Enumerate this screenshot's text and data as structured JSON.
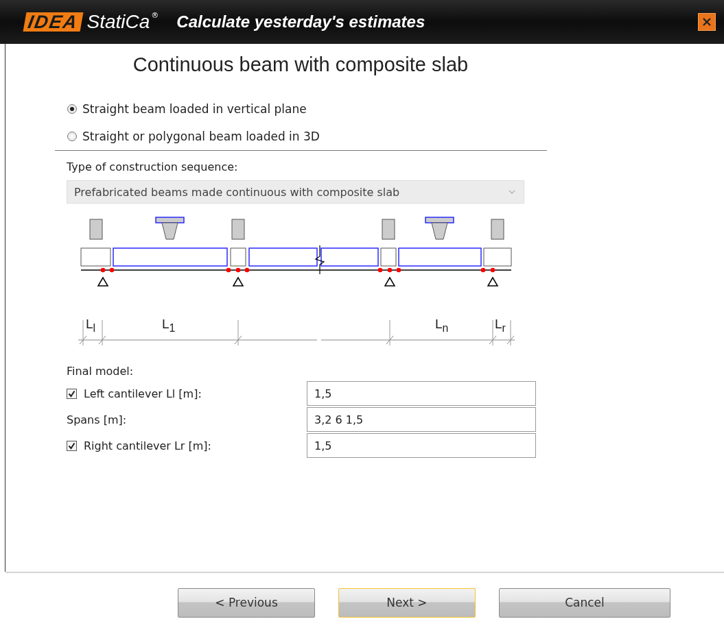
{
  "window": {
    "logo_mark": "IDEA",
    "logo_name": "StatiCa",
    "logo_registered": "®",
    "title": "Calculate yesterday's estimates"
  },
  "heading": "Continuous beam with composite slab",
  "beam_types": [
    {
      "label": "Straight beam loaded in vertical plane",
      "selected": true
    },
    {
      "label": "Straight or polygonal beam loaded in 3D",
      "selected": false
    }
  ],
  "sequence": {
    "label": "Type of construction sequence:",
    "value": "Prefabricated beams made continuous with composite slab",
    "disabled": true
  },
  "diagram": {
    "dimension_labels": [
      "L$_{l}$",
      "L$_{1}$",
      "L$_{n}$",
      "L$_{r}$"
    ]
  },
  "final_model": {
    "label": "Final model:",
    "fields": [
      {
        "kind": "checkbox",
        "label": "Left cantilever Ll [m]:",
        "checked": true,
        "value": "1,5"
      },
      {
        "kind": "plain",
        "label": "Spans [m]:",
        "value": "3,2 6 1,5"
      },
      {
        "kind": "checkbox",
        "label": "Right cantilever Lr [m]:",
        "checked": true,
        "value": "1,5"
      }
    ]
  },
  "buttons": [
    {
      "label": "< Previous",
      "focused": false
    },
    {
      "label": "Next >",
      "focused": true
    },
    {
      "label": "Cancel",
      "focused": false
    }
  ]
}
